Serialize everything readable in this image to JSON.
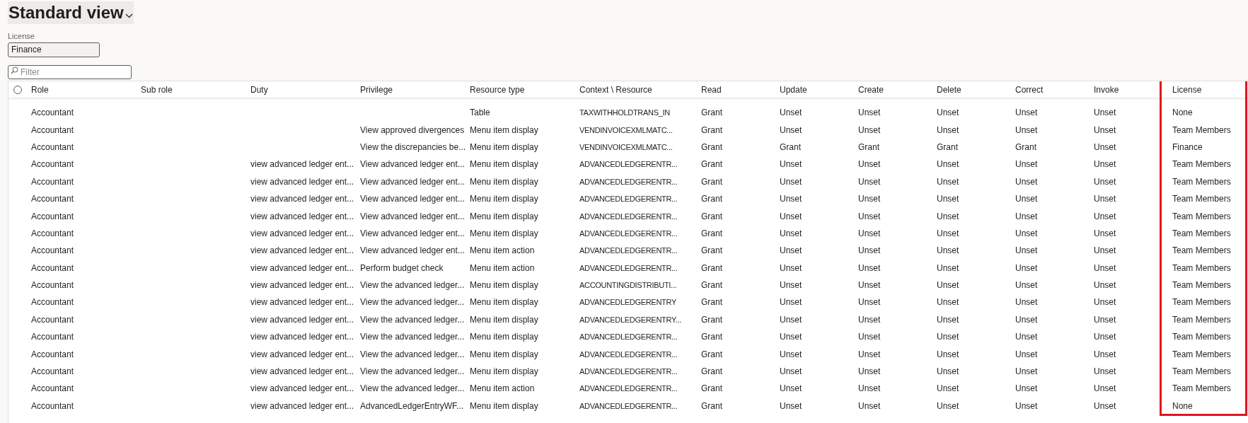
{
  "view_title": "Standard view",
  "license_field": {
    "label": "License",
    "value": "Finance"
  },
  "filter": {
    "placeholder": "Filter"
  },
  "select_all": {
    "checked": false
  },
  "columns": [
    {
      "label": "Role",
      "highlighted": false
    },
    {
      "label": "Sub role",
      "highlighted": false
    },
    {
      "label": "Duty",
      "highlighted": false
    },
    {
      "label": "Privilege",
      "highlighted": false
    },
    {
      "label": "Resource type",
      "highlighted": false
    },
    {
      "label": "Context \\ Resource",
      "highlighted": false
    },
    {
      "label": "Read",
      "highlighted": false
    },
    {
      "label": "Update",
      "highlighted": false
    },
    {
      "label": "Create",
      "highlighted": false
    },
    {
      "label": "Delete",
      "highlighted": false
    },
    {
      "label": "Correct",
      "highlighted": false
    },
    {
      "label": "Invoke",
      "highlighted": false
    },
    {
      "label": "License",
      "highlighted": true
    }
  ],
  "rows": [
    [
      "Accountant",
      null,
      null,
      null,
      "Table",
      "TAXWITHHOLDTRANS_IN",
      "Grant",
      "Unset",
      "Unset",
      "Unset",
      "Unset",
      "Unset",
      "None"
    ],
    [
      "Accountant",
      null,
      null,
      "View approved divergences",
      "Menu item display",
      "VENDINVOICEXMLMATC...",
      "Grant",
      "Unset",
      "Unset",
      "Unset",
      "Unset",
      "Unset",
      "Team Members"
    ],
    [
      "Accountant",
      null,
      null,
      "View the discrepancies be...",
      "Menu item display",
      "VENDINVOICEXMLMATC...",
      "Grant",
      "Grant",
      "Grant",
      "Grant",
      "Grant",
      "Unset",
      "Finance"
    ],
    [
      "Accountant",
      null,
      "view advanced ledger ent...",
      "View advanced ledger ent...",
      "Menu item display",
      "ADVANCEDLEDGERENTR...",
      "Grant",
      "Unset",
      "Unset",
      "Unset",
      "Unset",
      "Unset",
      "Team Members"
    ],
    [
      "Accountant",
      null,
      "view advanced ledger ent...",
      "View advanced ledger ent...",
      "Menu item display",
      "ADVANCEDLEDGERENTR...",
      "Grant",
      "Unset",
      "Unset",
      "Unset",
      "Unset",
      "Unset",
      "Team Members"
    ],
    [
      "Accountant",
      null,
      "view advanced ledger ent...",
      "View advanced ledger ent...",
      "Menu item display",
      "ADVANCEDLEDGERENTR...",
      "Grant",
      "Unset",
      "Unset",
      "Unset",
      "Unset",
      "Unset",
      "Team Members"
    ],
    [
      "Accountant",
      null,
      "view advanced ledger ent...",
      "View advanced ledger ent...",
      "Menu item display",
      "ADVANCEDLEDGERENTR...",
      "Grant",
      "Unset",
      "Unset",
      "Unset",
      "Unset",
      "Unset",
      "Team Members"
    ],
    [
      "Accountant",
      null,
      "view advanced ledger ent...",
      "View advanced ledger ent...",
      "Menu item display",
      "ADVANCEDLEDGERENTR...",
      "Grant",
      "Unset",
      "Unset",
      "Unset",
      "Unset",
      "Unset",
      "Team Members"
    ],
    [
      "Accountant",
      null,
      "view advanced ledger ent...",
      "View advanced ledger ent...",
      "Menu item action",
      "ADVANCEDLEDGERENTR...",
      "Grant",
      "Unset",
      "Unset",
      "Unset",
      "Unset",
      "Unset",
      "Team Members"
    ],
    [
      "Accountant",
      null,
      "view advanced ledger ent...",
      "Perform budget check",
      "Menu item action",
      "ADVANCEDLEDGERENTR...",
      "Grant",
      "Unset",
      "Unset",
      "Unset",
      "Unset",
      "Unset",
      "Team Members"
    ],
    [
      "Accountant",
      null,
      "view advanced ledger ent...",
      "View the advanced ledger...",
      "Menu item display",
      "ACCOUNTINGDISTRIBUTI...",
      "Grant",
      "Unset",
      "Unset",
      "Unset",
      "Unset",
      "Unset",
      "Team Members"
    ],
    [
      "Accountant",
      null,
      "view advanced ledger ent...",
      "View the advanced ledger...",
      "Menu item display",
      "ADVANCEDLEDGERENTRY",
      "Grant",
      "Unset",
      "Unset",
      "Unset",
      "Unset",
      "Unset",
      "Team Members"
    ],
    [
      "Accountant",
      null,
      "view advanced ledger ent...",
      "View the advanced ledger...",
      "Menu item display",
      "ADVANCEDLEDGERENTRY...",
      "Grant",
      "Unset",
      "Unset",
      "Unset",
      "Unset",
      "Unset",
      "Team Members"
    ],
    [
      "Accountant",
      null,
      "view advanced ledger ent...",
      "View the advanced ledger...",
      "Menu item display",
      "ADVANCEDLEDGERENTR...",
      "Grant",
      "Unset",
      "Unset",
      "Unset",
      "Unset",
      "Unset",
      "Team Members"
    ],
    [
      "Accountant",
      null,
      "view advanced ledger ent...",
      "View the advanced ledger...",
      "Menu item display",
      "ADVANCEDLEDGERENTR...",
      "Grant",
      "Unset",
      "Unset",
      "Unset",
      "Unset",
      "Unset",
      "Team Members"
    ],
    [
      "Accountant",
      null,
      "view advanced ledger ent...",
      "View the advanced ledger...",
      "Menu item display",
      "ADVANCEDLEDGERENTR...",
      "Grant",
      "Unset",
      "Unset",
      "Unset",
      "Unset",
      "Unset",
      "Team Members"
    ],
    [
      "Accountant",
      null,
      "view advanced ledger ent...",
      "View the advanced ledger...",
      "Menu item action",
      "ADVANCEDLEDGERENTR...",
      "Grant",
      "Unset",
      "Unset",
      "Unset",
      "Unset",
      "Unset",
      "Team Members"
    ],
    [
      "Accountant",
      null,
      "view advanced ledger ent...",
      "AdvancedLedgerEntryWF...",
      "Menu item display",
      "ADVANCEDLEDGERENTR...",
      "Grant",
      "Unset",
      "Unset",
      "Unset",
      "Unset",
      "Unset",
      "None"
    ]
  ]
}
